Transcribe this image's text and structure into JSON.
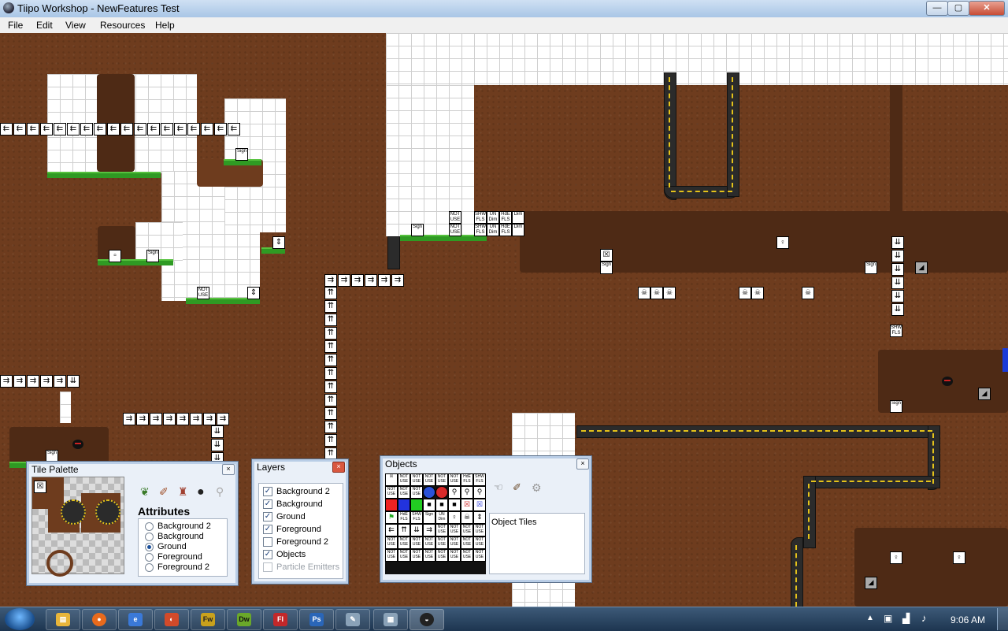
{
  "window": {
    "title": "Tiipo Workshop - NewFeatures Test",
    "buttons": {
      "minimize": "—",
      "maximize": "▢",
      "close": "✕"
    }
  },
  "menu": [
    "File",
    "Edit",
    "View",
    "Resources",
    "Help"
  ],
  "canvas": {
    "tile_labels": {
      "sign": "Sign",
      "not_use": "NOT USE",
      "shw_fls": "SHW FLS",
      "un_dim": "UN Dim",
      "hide_fls": "HdE FLS",
      "dim": "Dim"
    }
  },
  "tile_palette": {
    "title": "Tile Palette",
    "close": "×",
    "tool_icons": [
      "leaf-brush-icon",
      "eraser-icon",
      "stamp-icon",
      "bomb-icon",
      "magnifier-icon"
    ],
    "attributes_heading": "Attributes",
    "layers": [
      "Background 2",
      "Background",
      "Ground",
      "Foreground",
      "Foreground 2"
    ],
    "selected": "Ground"
  },
  "layers_window": {
    "title": "Layers",
    "close": "×",
    "items": [
      {
        "label": "Background 2",
        "checked": true,
        "enabled": true
      },
      {
        "label": "Background",
        "checked": true,
        "enabled": true
      },
      {
        "label": "Ground",
        "checked": true,
        "enabled": true
      },
      {
        "label": "Foreground",
        "checked": true,
        "enabled": true
      },
      {
        "label": "Foreground 2",
        "checked": false,
        "enabled": true
      },
      {
        "label": "Objects",
        "checked": true,
        "enabled": true
      },
      {
        "label": "Particle Emitters",
        "checked": false,
        "enabled": false
      }
    ]
  },
  "objects_window": {
    "title": "Objects",
    "close": "×",
    "info_label": "Object Tiles",
    "tool_icons": [
      "pointer-hand-icon",
      "brush-icon",
      "gear-icon"
    ]
  },
  "taskbar": {
    "apps": [
      {
        "name": "explorer",
        "glyph": "▤",
        "color": "#e8b53a"
      },
      {
        "name": "firefox",
        "glyph": "●",
        "color": "#e86a1c"
      },
      {
        "name": "ie",
        "glyph": "e",
        "color": "#3a79d8"
      },
      {
        "name": "media",
        "glyph": "◐",
        "color": "#d24a2a"
      },
      {
        "name": "fireworks",
        "glyph": "Fw",
        "color": "#c9a11c"
      },
      {
        "name": "dreamweaver",
        "glyph": "Dw",
        "color": "#6aa82a"
      },
      {
        "name": "flash",
        "glyph": "Fl",
        "color": "#c2282a"
      },
      {
        "name": "photoshop",
        "glyph": "Ps",
        "color": "#2a66b8"
      },
      {
        "name": "notepad",
        "glyph": "✎",
        "color": "#8aa2b8"
      },
      {
        "name": "clipboard",
        "glyph": "▦",
        "color": "#8aa2b8"
      },
      {
        "name": "tiipo",
        "glyph": "◒",
        "color": "#222"
      }
    ],
    "clock": "9:06 AM"
  }
}
